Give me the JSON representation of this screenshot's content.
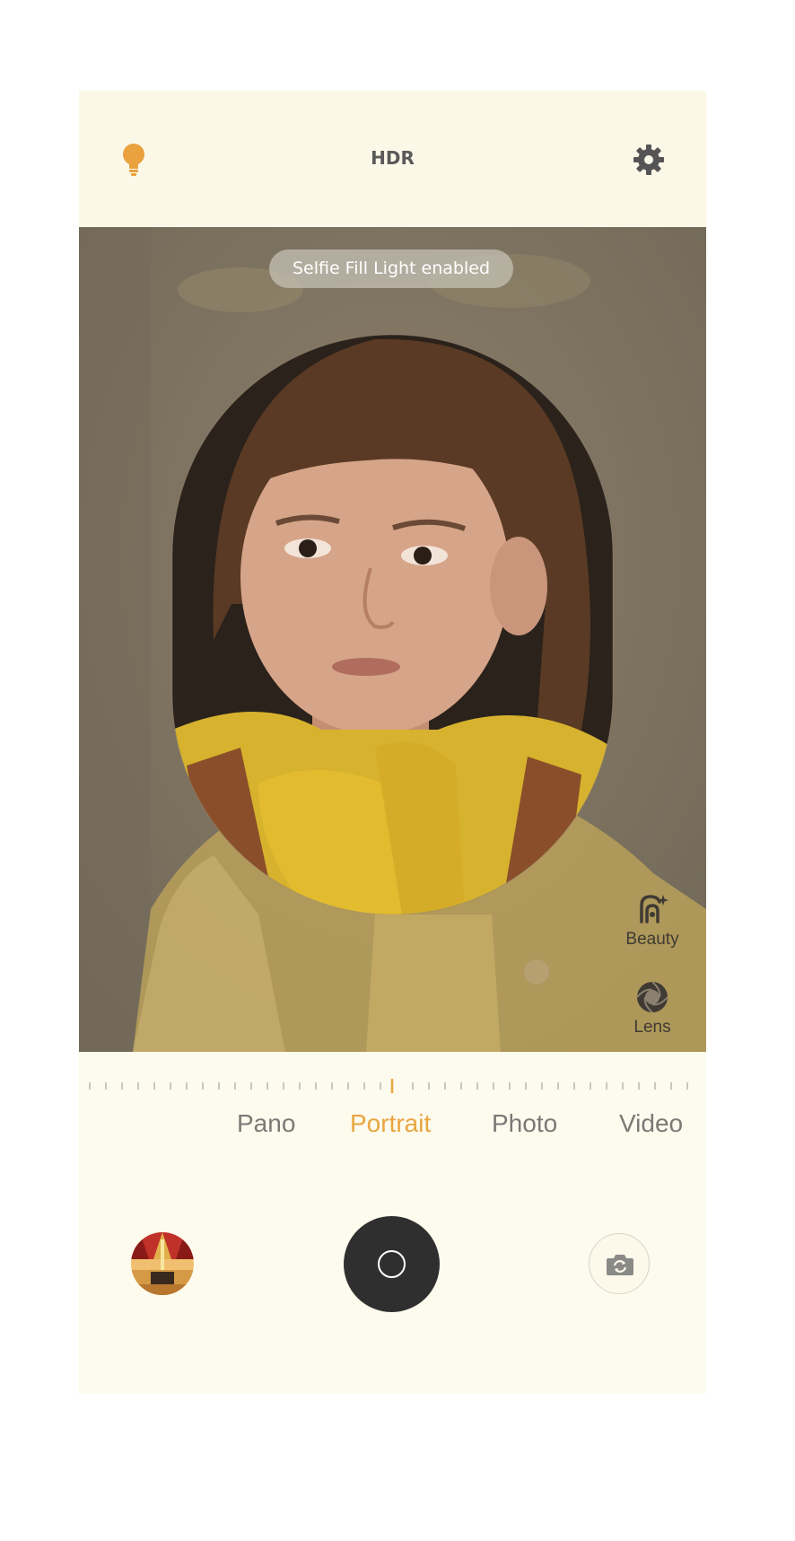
{
  "topbar": {
    "hdr_label": "HDR",
    "icons": {
      "left": "lightbulb-icon",
      "right": "gear-icon"
    }
  },
  "viewfinder": {
    "toast": "Selfie Fill Light enabled",
    "tools": [
      {
        "label": "Beauty",
        "icon": "beauty-icon"
      },
      {
        "label": "Lens",
        "icon": "lens-icon"
      }
    ]
  },
  "modes": {
    "items": [
      "Pano",
      "Portrait",
      "Photo",
      "Video"
    ],
    "selected": "Portrait"
  },
  "controls": {
    "gallery_icon": "gallery-thumbnail",
    "shutter_icon": "shutter-icon",
    "switch_icon": "camera-switch-icon"
  },
  "colors": {
    "accent": "#e8a640",
    "background": "#fdfaee",
    "shutter": "#2f2f2f",
    "mode_inactive": "#7a7a75"
  }
}
